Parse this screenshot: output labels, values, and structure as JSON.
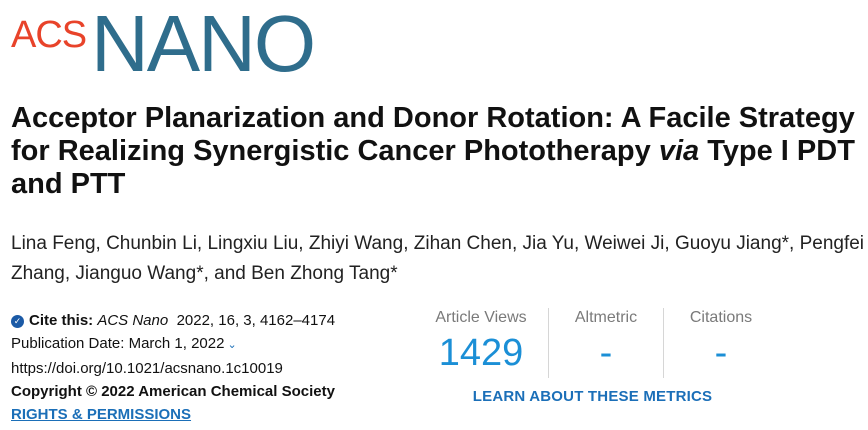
{
  "logo": {
    "acs": "ACS",
    "nano": "NANO"
  },
  "title": {
    "part1": "Acceptor Planarization and Donor Rotation: A Facile Strategy for Realizing Synergistic Cancer Phototherapy ",
    "italic": "via",
    "part2": " Type I PDT and PTT"
  },
  "authors": "Lina Feng, Chunbin Li, Lingxiu Liu, Zhiyi Wang, Zihan Chen, Jia Yu, Weiwei Ji, Guoyu Jiang*, Pengfei Zhang, Jianguo Wang*, and Ben Zhong Tang*",
  "citation": {
    "label": "Cite this:",
    "journal": "ACS Nano",
    "details": "2022, 16, 3, 4162–4174",
    "pub_date": "Publication Date: March 1, 2022",
    "doi": "https://doi.org/10.1021/acsnano.1c10019",
    "copyright": "Copyright © 2022 American Chemical Society",
    "rights": "RIGHTS & PERMISSIONS"
  },
  "metrics": [
    {
      "label": "Article Views",
      "value": "1429"
    },
    {
      "label": "Altmetric",
      "value": "-"
    },
    {
      "label": "Citations",
      "value": "-"
    }
  ],
  "learn_more": "LEARN ABOUT THESE METRICS",
  "colors": {
    "acs_red": "#e8432a",
    "nano_blue": "#2f6d8c",
    "link_blue": "#1b6fb8",
    "metric_blue": "#1b8fd6"
  }
}
